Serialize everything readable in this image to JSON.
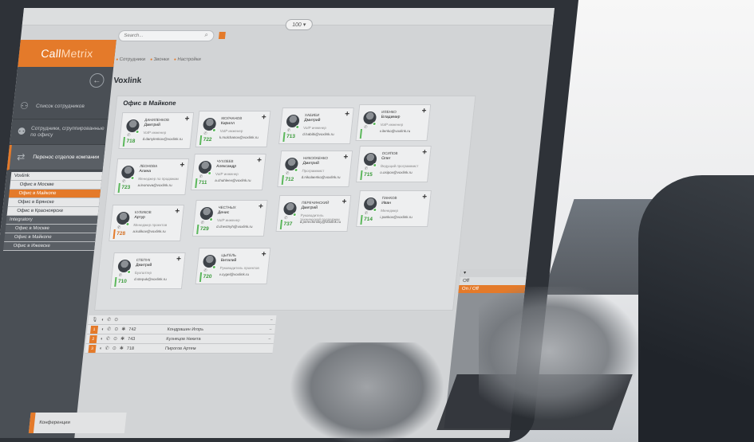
{
  "app": {
    "logo_part1": "Call",
    "logo_part2": "Metrix",
    "zoom": "100",
    "corner_number": "720"
  },
  "sidebar": {
    "items": [
      {
        "label": "Список сотрудников",
        "icon": "users-icon"
      },
      {
        "label": "Сотрудники, сгруппированные по офису",
        "icon": "group-icon"
      },
      {
        "label": "Перенос отделов компании",
        "icon": "transfer-icon"
      }
    ],
    "tree": [
      {
        "label": "Voxlink",
        "level": 1,
        "state": "normal"
      },
      {
        "label": "Офис в Москве",
        "level": 2,
        "state": "normal"
      },
      {
        "label": "Офис в Майкопе",
        "level": 2,
        "state": "selected"
      },
      {
        "label": "Офис в Брянске",
        "level": 2,
        "state": "normal"
      },
      {
        "label": "Офис в Красноярске",
        "level": 2,
        "state": "normal"
      },
      {
        "label": "Integratory",
        "level": 1,
        "state": "dark"
      },
      {
        "label": "Офис в Москве",
        "level": 2,
        "state": "dark"
      },
      {
        "label": "Офис в Майкопе",
        "level": 2,
        "state": "dark"
      },
      {
        "label": "Офис в Ижевске",
        "level": 2,
        "state": "dark"
      }
    ],
    "footer_tab": "Конференции"
  },
  "main": {
    "search_placeholder": "Search...",
    "breadcrumbs": [
      "Сотрудники",
      "Звонки",
      "Настройки"
    ],
    "company": "Voxlink",
    "department": "Офис в Майкопе"
  },
  "cards": [
    {
      "last": "ДАНИЛЕНКОВ",
      "first": "Дмитрий",
      "role": "VoIP инженер",
      "email": "d.danylenkov@voxlink.ru",
      "ext": "718",
      "status": "green"
    },
    {
      "last": "МОЛЧАНОВ",
      "first": "Кирилл",
      "role": "VoIP инженер",
      "email": "k.molchanov@voxlink.ru",
      "ext": "722",
      "status": "green"
    },
    {
      "last": "ХАБИБИ",
      "first": "Дмитрий",
      "role": "VoIP инженер",
      "email": "d.habibi@voxlink.ru",
      "ext": "713",
      "status": "green"
    },
    {
      "last": "ИЛЕНКО",
      "first": "Владимир",
      "role": "VoIP инженер",
      "email": "v.ilenko@voxlink.ru",
      "ext": "",
      "status": "green"
    },
    {
      "last": "ЛЕОНОВА",
      "first": "Алина",
      "role": "Менеджер по продажам",
      "email": "a.leonova@voxlink.ru",
      "ext": "723",
      "status": "green"
    },
    {
      "last": "ЧУХЛЕЕВ",
      "first": "Александр",
      "role": "VoIP инженер",
      "email": "a.chuhleev@voxlink.ru",
      "ext": "711",
      "status": "green"
    },
    {
      "last": "НИКОЛАЕНКО",
      "first": "Дмитрий",
      "role": "Программист",
      "email": "d.nikolaenko@voxlink.ru",
      "ext": "712",
      "status": "green"
    },
    {
      "last": "ОСИПОВ",
      "first": "Олег",
      "role": "Ведущий программист",
      "email": "o.osipov@voxlink.ru",
      "ext": "715",
      "status": "green"
    },
    {
      "last": "КУЛИКОВ",
      "first": "Артур",
      "role": "Менеджер проектов",
      "email": "a.kulikov@voxlink.ru",
      "ext": "728",
      "status": "orange"
    },
    {
      "last": "ЧЕСТНЫХ",
      "first": "Денис",
      "role": "VoIP инженер",
      "email": "d.chestnyh@voxlink.ru",
      "ext": "729",
      "status": "green"
    },
    {
      "last": "ПЕРЕЧИНСКИЙ",
      "first": "Дмитрий",
      "role": "Руководитель технической поддержки",
      "email": "d.perechinsky@voxlink.ru",
      "ext": "737",
      "status": "green"
    },
    {
      "last": "ПАНКОВ",
      "first": "Иван",
      "role": "Менеджер",
      "email": "i.pankov@voxlink.ru",
      "ext": "714",
      "status": "green"
    },
    {
      "last": "СТЕПУК",
      "first": "Дмитрий",
      "role": "Бухгалтер",
      "email": "d.stepuk@voxlink.ru",
      "ext": "710",
      "status": "green"
    },
    {
      "last": "ЦЫГЕЛЬ",
      "first": "Виталий",
      "role": "Руководитель проектов",
      "email": "v.cygel@voxlink.ru",
      "ext": "720",
      "status": "green"
    }
  ],
  "calls": [
    {
      "n": "",
      "ext": "",
      "who": ""
    },
    {
      "n": "1",
      "ext": "742",
      "who": "Кондрашин Игорь"
    },
    {
      "n": "2",
      "ext": "743",
      "who": "Кузнецов Никита"
    },
    {
      "n": "3",
      "ext": "718",
      "who": "Пирогов Артем"
    }
  ],
  "right_panel": {
    "rows": [
      "Off",
      "On / Off"
    ]
  }
}
